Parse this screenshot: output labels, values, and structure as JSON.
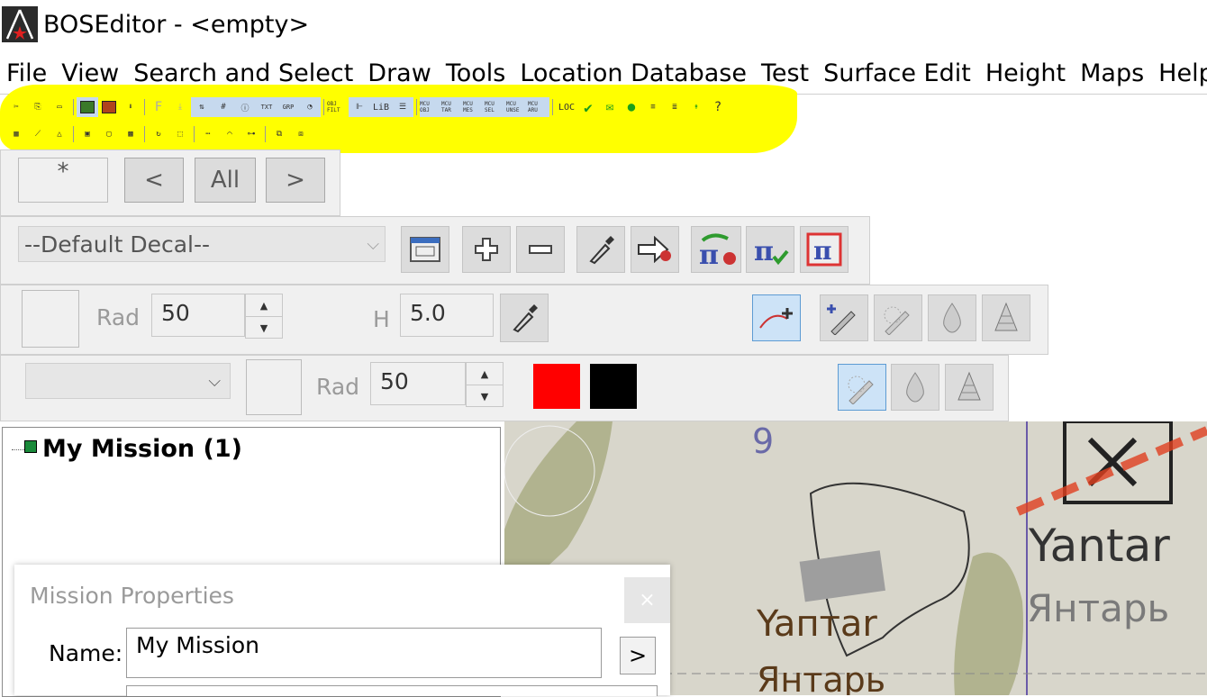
{
  "window": {
    "title": "BOSEditor - <empty>"
  },
  "menu": [
    "File",
    "View",
    "Search and Select",
    "Draw",
    "Tools",
    "Location Database",
    "Test",
    "Surface Edit",
    "Height",
    "Maps",
    "Help"
  ],
  "toolbar": {
    "row1_text": [
      "F",
      "TXT",
      "GRP",
      "OBJ FILT",
      "LiB",
      "MCU OBJ",
      "MCU TAR",
      "MCU MES",
      "MCU SEL",
      "MCU UNSE",
      "MCU ARU",
      "LOC"
    ]
  },
  "nav": {
    "filter_label": "*",
    "prev_label": "<",
    "all_label": "All",
    "next_label": ">"
  },
  "decal": {
    "selected": "--Default Decal--"
  },
  "height_row": {
    "rad_label": "Rad",
    "rad_value": "50",
    "h_label": "H",
    "h_value": "5.0"
  },
  "paint_row": {
    "rad_label": "Rad",
    "rad_value": "50",
    "color1": "#ff0000",
    "color2": "#000000"
  },
  "tree": {
    "root_label": "My Mission (1)"
  },
  "map": {
    "labels": [
      "9",
      "Yantar",
      "Янтарь",
      "Yaптar",
      "Янтарь"
    ]
  },
  "dialog": {
    "title": "Mission Properties",
    "close_label": "×",
    "name_label": "Name:",
    "name_value": "My Mission",
    "go_label": ">"
  }
}
